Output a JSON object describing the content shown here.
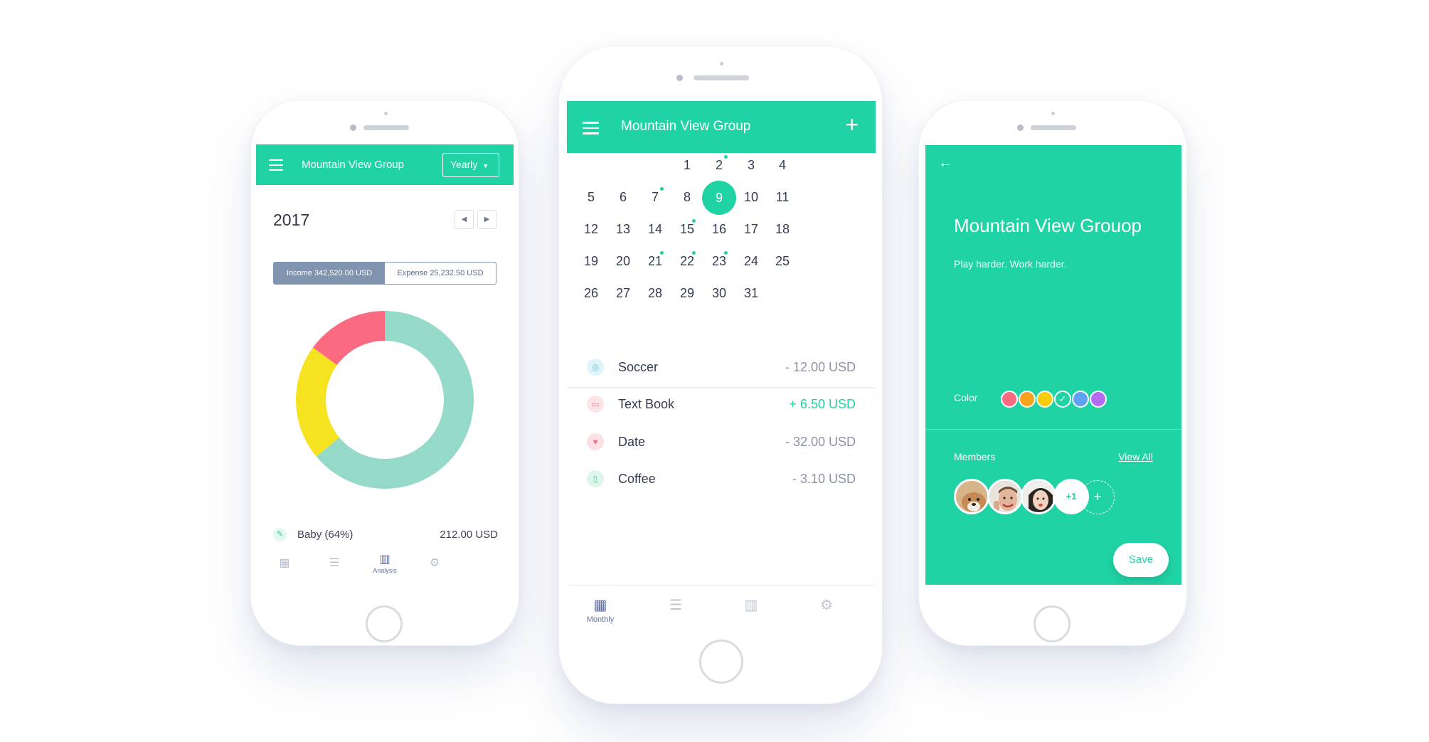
{
  "phone1": {
    "title": "Mountain View Group",
    "period_label": "Yearly",
    "year": "2017",
    "income_tab": "Income 342,520.00 USD",
    "expense_tab": "Expense 25,232.50 USD",
    "donut": {
      "segments": [
        {
          "category": "Baby",
          "percent": 64,
          "color": "#95d9c8"
        },
        {
          "category": "",
          "percent": 21,
          "color": "#f6e31f"
        },
        {
          "category": "",
          "percent": 15,
          "color": "#fa6b82"
        }
      ]
    },
    "legend": {
      "name": "Baby (64%)",
      "amount": "212.00 USD"
    },
    "tabs": {
      "analysis_label": "Analysis"
    }
  },
  "phone2": {
    "title": "Mountain View Group",
    "calendar": {
      "days": [
        [
          "",
          "",
          "",
          "1",
          "2",
          "3",
          "4"
        ],
        [
          "5",
          "6",
          "7",
          "8",
          "9",
          "10",
          "11"
        ],
        [
          "12",
          "13",
          "14",
          "15",
          "16",
          "17",
          "18"
        ],
        [
          "19",
          "20",
          "21",
          "22",
          "23",
          "24",
          "25"
        ],
        [
          "26",
          "27",
          "28",
          "29",
          "30",
          "31",
          ""
        ]
      ],
      "selected_day": "9",
      "event_days": [
        "2",
        "7",
        "15",
        "21",
        "22",
        "23"
      ]
    },
    "transactions": [
      {
        "name": "Soccer",
        "amount": "- 12.00 USD",
        "positive": false,
        "icon": "ball-icon",
        "icon_color": "#dff4fb",
        "icon_fg": "#7cc4dc"
      },
      {
        "name": "Text Book",
        "amount": "+ 6.50 USD",
        "positive": true,
        "icon": "book-icon",
        "icon_color": "#fde4e8",
        "icon_fg": "#f48a9c"
      },
      {
        "name": "Date",
        "amount": "- 32.00 USD",
        "positive": false,
        "icon": "heart-icon",
        "icon_color": "#fde0e4",
        "icon_fg": "#f47288"
      },
      {
        "name": "Coffee",
        "amount": "- 3.10 USD",
        "positive": false,
        "icon": "cup-icon",
        "icon_color": "#ddf6ec",
        "icon_fg": "#56cfa2"
      }
    ],
    "tabs": {
      "monthly_label": "Monthly"
    }
  },
  "phone3": {
    "title": "Mountain View Grouop",
    "subtitle": "Play harder. Work harder.",
    "color_label": "Color",
    "swatches": [
      "#fa6b82",
      "#f7a21c",
      "#f7cc0d",
      "selected",
      "#5ea0f2",
      "#b66cf0"
    ],
    "members_label": "Members",
    "view_all": "View All",
    "extra_members": "+1",
    "add_member": "+",
    "save_label": "Save"
  }
}
